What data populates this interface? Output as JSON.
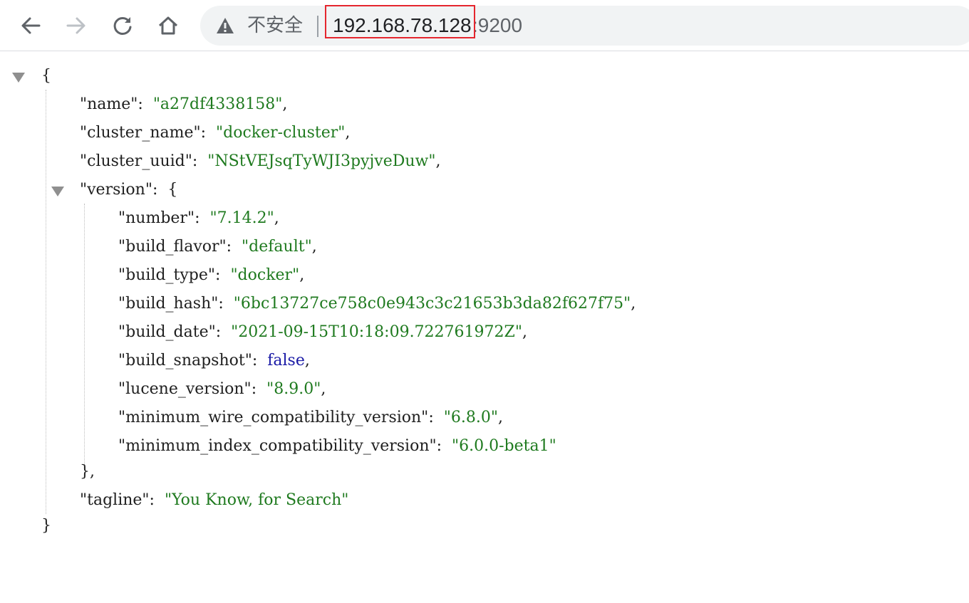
{
  "browser": {
    "security_label": "不安全",
    "url_host": "192.168.78.128",
    "url_port": ":9200",
    "highlight_color": "#e5262e"
  },
  "icons": {
    "back": "arrow-left-icon",
    "forward": "arrow-right-icon",
    "reload": "reload-icon",
    "home": "home-icon",
    "security": "warning-triangle-icon"
  },
  "json": {
    "open_brace": "{",
    "close_brace": "}",
    "name_key": "\"name\"",
    "name_val": "\"a27df4338158\"",
    "cluster_name_key": "\"cluster_name\"",
    "cluster_name_val": "\"docker-cluster\"",
    "cluster_uuid_key": "\"cluster_uuid\"",
    "cluster_uuid_val": "\"NStVEJsqTyWJI3pyjveDuw\"",
    "version_key": "\"version\"",
    "version_open": "{",
    "version_close": "},",
    "version": [
      {
        "key": "\"number\"",
        "val": "\"7.14.2\"",
        "type": "str",
        "comma": ","
      },
      {
        "key": "\"build_flavor\"",
        "val": "\"default\"",
        "type": "str",
        "comma": ","
      },
      {
        "key": "\"build_type\"",
        "val": "\"docker\"",
        "type": "str",
        "comma": ","
      },
      {
        "key": "\"build_hash\"",
        "val": "\"6bc13727ce758c0e943c3c21653b3da82f627f75\"",
        "type": "str",
        "comma": ","
      },
      {
        "key": "\"build_date\"",
        "val": "\"2021-09-15T10:18:09.722761972Z\"",
        "type": "str",
        "comma": ","
      },
      {
        "key": "\"build_snapshot\"",
        "val": "false",
        "type": "bool",
        "comma": ","
      },
      {
        "key": "\"lucene_version\"",
        "val": "\"8.9.0\"",
        "type": "str",
        "comma": ","
      },
      {
        "key": "\"minimum_wire_compatibility_version\"",
        "val": "\"6.8.0\"",
        "type": "str",
        "comma": ","
      },
      {
        "key": "\"minimum_index_compatibility_version\"",
        "val": "\"6.0.0-beta1\"",
        "type": "str",
        "comma": ""
      }
    ],
    "tagline_key": "\"tagline\"",
    "tagline_val": "\"You Know, for Search\""
  }
}
